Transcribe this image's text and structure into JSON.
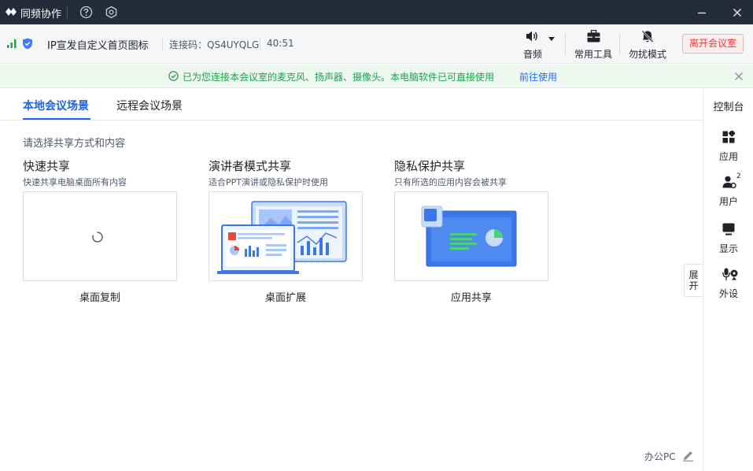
{
  "app": {
    "name": "同频协作"
  },
  "colors": {
    "titlebar": "#252b3b",
    "accent": "#1f64e0",
    "success": "#1e9f4a",
    "danger": "#e5383b"
  },
  "meeting": {
    "title": "IP宣发自定义首页图标",
    "code_label": "连接码：QS4UYQLG",
    "elapsed": "40:51"
  },
  "toolbar": {
    "audio": "音频",
    "tools": "常用工具",
    "dnd": "勿扰模式",
    "leave": "离开会议室"
  },
  "notice": {
    "text": "已为您连接本会议室的麦克风、扬声器、摄像头。本电脑软件已可直接使用",
    "link": "前往使用"
  },
  "tabs": [
    {
      "label": "本地会议场景",
      "active": true
    },
    {
      "label": "远程会议场景",
      "active": false
    }
  ],
  "main": {
    "hint": "请选择共享方式和内容",
    "cards": [
      {
        "title": "快速共享",
        "sub": "快速共享电脑桌面所有内容",
        "caption": "桌面复制"
      },
      {
        "title": "演讲者模式共享",
        "sub": "适合PPT演讲或隐私保护时使用",
        "caption": "桌面扩展"
      },
      {
        "title": "隐私保护共享",
        "sub": "只有所选的应用内容会被共享",
        "caption": "应用共享"
      }
    ]
  },
  "sidebar": {
    "title": "控制台",
    "items": [
      {
        "label": "应用",
        "icon": "apps-icon"
      },
      {
        "label": "用户",
        "icon": "user-icon",
        "badge": "2"
      },
      {
        "label": "显示",
        "icon": "display-icon"
      },
      {
        "label": "外设",
        "icon": "peripheral-icon"
      }
    ]
  },
  "expand_handle": "展开",
  "footer": {
    "device": "办公PC"
  }
}
